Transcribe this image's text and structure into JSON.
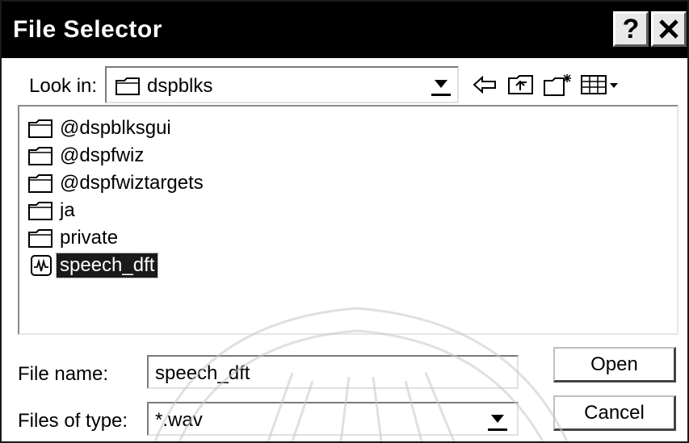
{
  "window": {
    "title": "File Selector"
  },
  "title_buttons": {
    "help": "?",
    "close": "X"
  },
  "look_in": {
    "label": "Look in:",
    "value": "dspblks"
  },
  "toolbar": {
    "icons": [
      "back-icon",
      "up-folder-icon",
      "new-folder-icon",
      "view-menu-icon"
    ]
  },
  "file_list": {
    "items": [
      {
        "name": "@dspblksgui",
        "type": "folder",
        "selected": false
      },
      {
        "name": "@dspfwiz",
        "type": "folder",
        "selected": false
      },
      {
        "name": "@dspfwiztargets",
        "type": "folder",
        "selected": false
      },
      {
        "name": "ja",
        "type": "folder",
        "selected": false
      },
      {
        "name": "private",
        "type": "folder",
        "selected": false
      },
      {
        "name": "speech_dft",
        "type": "wave-file",
        "selected": true
      }
    ]
  },
  "file_name": {
    "label": "File name:",
    "value": "speech_dft"
  },
  "file_type": {
    "label": "Files of type:",
    "value": "*.wav"
  },
  "buttons": {
    "open": "Open",
    "cancel": "Cancel"
  }
}
